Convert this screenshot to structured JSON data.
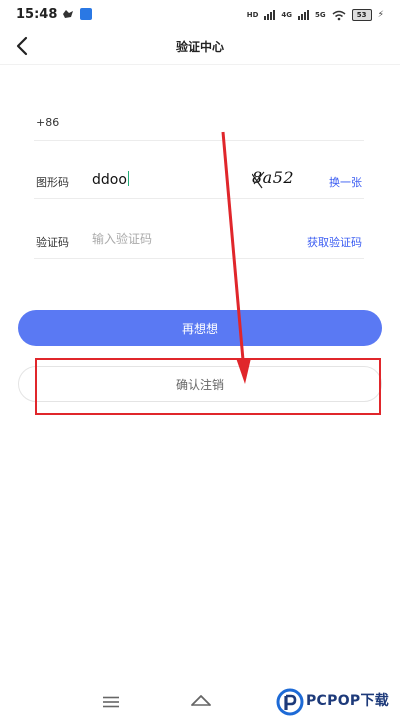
{
  "status_bar": {
    "time": "15:48",
    "network_tags": [
      "HD",
      "4G",
      "5G"
    ],
    "battery": "53"
  },
  "nav": {
    "title": "验证中心"
  },
  "form": {
    "phone_prefix": "+86",
    "captcha_row": {
      "label": "图形码",
      "value": "ddoo",
      "captcha_image_text": "8a52",
      "refresh_label": "换一张"
    },
    "code_row": {
      "label": "验证码",
      "placeholder": "输入验证码",
      "get_code_label": "获取验证码"
    }
  },
  "buttons": {
    "rethink_label": "再想想",
    "confirm_cancel_label": "确认注销"
  },
  "annotation": {
    "color": "#e0262b"
  },
  "watermark": {
    "text": "PCPOP下载"
  },
  "colors": {
    "primary": "#5a79f3",
    "link": "#3a5cf2"
  }
}
